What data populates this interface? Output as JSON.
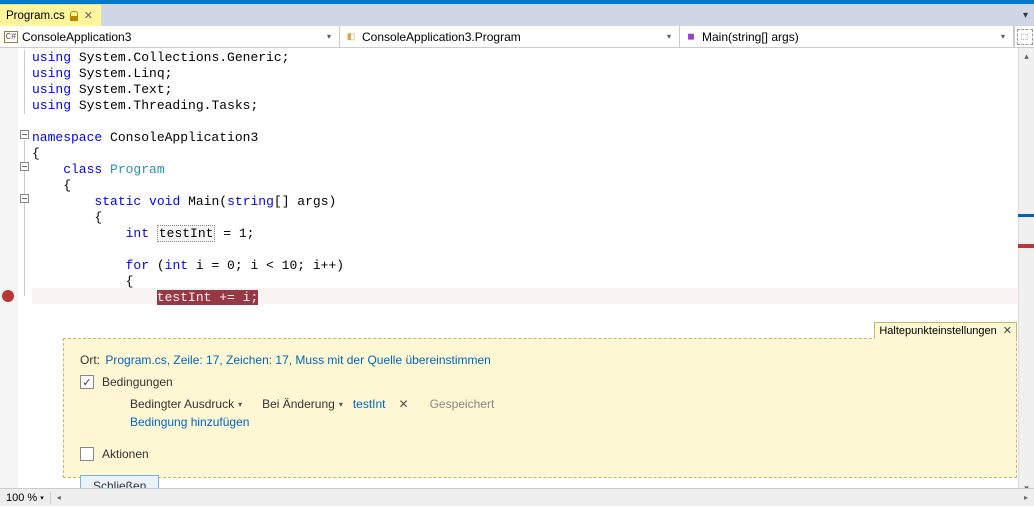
{
  "tab": {
    "filename": "Program.cs"
  },
  "nav": {
    "project": "ConsoleApplication3",
    "class": "ConsoleApplication3.Program",
    "method": "Main(string[] args)"
  },
  "code": {
    "l1": {
      "kw": "using",
      "ns": " System.Collections.Generic;"
    },
    "l2": {
      "kw": "using",
      "ns": " System.Linq;"
    },
    "l3": {
      "kw": "using",
      "ns": " System.Text;"
    },
    "l4": {
      "kw": "using",
      "ns": " System.Threading.Tasks;"
    },
    "l6": {
      "kw": "namespace",
      "nm": " ConsoleApplication3"
    },
    "l7": "{",
    "l8": {
      "kw": "    class",
      "nm": " Program"
    },
    "l9": "    {",
    "l10": {
      "pre": "        ",
      "kw1": "static",
      "sp1": " ",
      "kw2": "void",
      "sp2": " ",
      "fn": "Main(",
      "kw3": "string",
      "rest": "[] args)"
    },
    "l11": "        {",
    "l12": {
      "pre": "            ",
      "kw": "int",
      "sp": " ",
      "var": "testInt",
      "rest": " = 1;"
    },
    "l14": {
      "pre": "            ",
      "kw1": "for",
      "sp": " (",
      "kw2": "int",
      "rest": " i = 0; i < 10; i++)"
    },
    "l15": "            {",
    "l16": {
      "pre": "                ",
      "hl": "testInt += i;"
    }
  },
  "panel": {
    "title": "Haltepunkteinstellungen",
    "loc_label": "Ort:",
    "loc_link": "Program.cs, Zeile: 17, Zeichen: 17, Muss mit der Quelle übereinstimmen",
    "conditions": "Bedingungen",
    "cond_type": "Bedingter Ausdruck",
    "cond_when": "Bei Änderung",
    "cond_val": "testInt",
    "saved": "Gespeichert",
    "add_cond": "Bedingung hinzufügen",
    "actions": "Aktionen",
    "close": "Schließen"
  },
  "status": {
    "zoom": "100 %"
  }
}
